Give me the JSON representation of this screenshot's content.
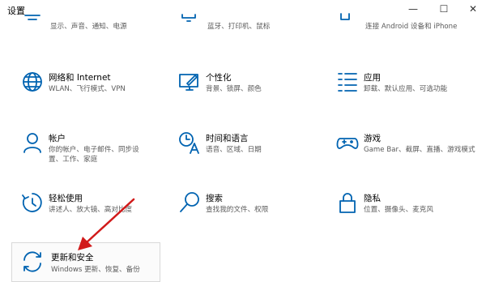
{
  "window": {
    "title": "设置",
    "minimize": "—",
    "maximize": "☐",
    "close": "✕"
  },
  "tiles_top": [
    {
      "desc": "显示、声音、通知、电源",
      "icon": "display-icon"
    },
    {
      "desc": "蓝牙、打印机、鼠标",
      "icon": "devices-icon"
    },
    {
      "desc": "连接 Android 设备和 iPhone",
      "icon": "phone-icon"
    }
  ],
  "tiles": [
    {
      "title": "网络和 Internet",
      "desc": "WLAN、飞行模式、VPN",
      "icon": "globe-icon"
    },
    {
      "title": "个性化",
      "desc": "背景、锁屏、颜色",
      "icon": "personalization-icon"
    },
    {
      "title": "应用",
      "desc": "卸载、默认应用、可选功能",
      "icon": "apps-icon"
    },
    {
      "title": "帐户",
      "desc": "你的帐户、电子邮件、同步设",
      "desc2": "置、工作、家庭",
      "icon": "person-icon"
    },
    {
      "title": "时间和语言",
      "desc": "语音、区域、日期",
      "icon": "time-language-icon"
    },
    {
      "title": "游戏",
      "desc": "Game Bar、截屏、直播、游戏模式",
      "icon": "gamepad-icon"
    },
    {
      "title": "轻松使用",
      "desc": "讲述人、放大镜、高对比度",
      "icon": "ease-of-access-icon"
    },
    {
      "title": "搜索",
      "desc": "查找我的文件、权限",
      "icon": "search-icon"
    },
    {
      "title": "隐私",
      "desc": "位置、摄像头、麦克风",
      "icon": "lock-icon"
    },
    {
      "title": "更新和安全",
      "desc": "Windows 更新、恢复、备份",
      "icon": "update-icon"
    }
  ],
  "colors": {
    "accent": "#0063b1",
    "arrow": "#d11a1a"
  }
}
